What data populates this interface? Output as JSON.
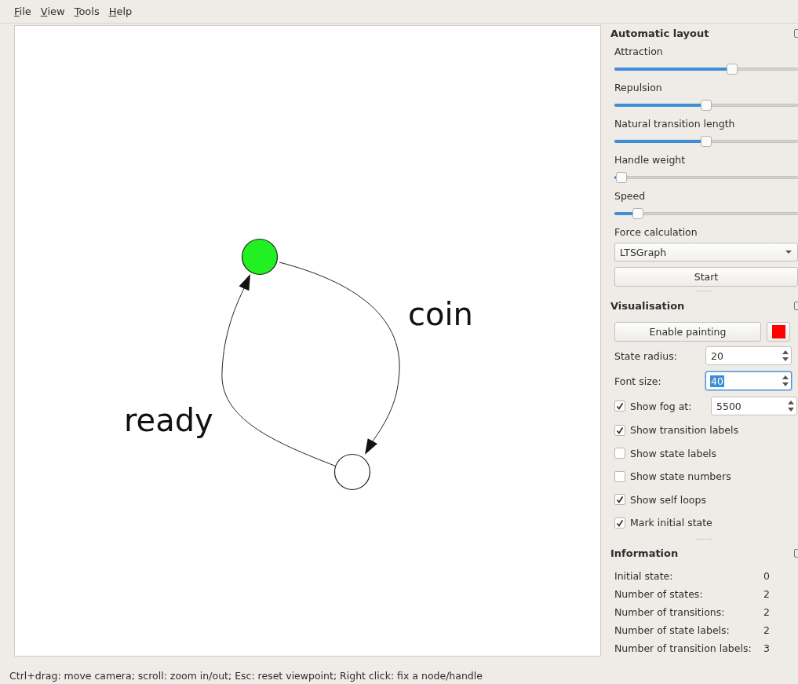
{
  "menu": [
    {
      "label": "File"
    },
    {
      "label": "View"
    },
    {
      "label": "Tools"
    },
    {
      "label": "Help"
    }
  ],
  "canvas": {
    "states": [
      {
        "color": "#22f022"
      },
      {
        "color": "#ffffff"
      }
    ],
    "transitions": [
      {
        "label": "coin"
      },
      {
        "label": "ready"
      }
    ]
  },
  "automatic_layout": {
    "title": "Automatic layout",
    "sliders": [
      {
        "label": "Attraction",
        "level": 0.64
      },
      {
        "label": "Repulsion",
        "level": 0.5
      },
      {
        "label": "Natural transition length",
        "level": 0.5
      },
      {
        "label": "Handle weight",
        "level": 0.04
      },
      {
        "label": "Speed",
        "level": 0.13
      }
    ],
    "force_calculation": {
      "label": "Force calculation",
      "value": "LTSGraph"
    },
    "start_button": "Start"
  },
  "visualisation": {
    "title": "Visualisation",
    "enable_painting": "Enable painting",
    "spinboxes": [
      {
        "label": "State radius:",
        "value": "20",
        "selected": false
      },
      {
        "label": "Font size:",
        "value": "40",
        "selected": true
      }
    ],
    "fog": {
      "label": "Show fog at:",
      "checked": true,
      "value": "5500"
    },
    "checkboxes": [
      {
        "label": "Show transition labels",
        "checked": true
      },
      {
        "label": "Show state labels",
        "checked": false
      },
      {
        "label": "Show state numbers",
        "checked": false
      },
      {
        "label": "Show self loops",
        "checked": true
      },
      {
        "label": "Mark initial state",
        "checked": true
      }
    ]
  },
  "information": {
    "title": "Information",
    "rows": [
      {
        "label": "Initial state:",
        "value": "0"
      },
      {
        "label": "Number of states:",
        "value": "2"
      },
      {
        "label": "Number of transitions:",
        "value": "2"
      },
      {
        "label": "Number of state labels:",
        "value": "2"
      },
      {
        "label": "Number of transition labels:",
        "value": "3"
      }
    ]
  },
  "status_bar": "Ctrl+drag: move camera; scroll: zoom in/out; Esc: reset viewpoint; Right click: fix a node/handle"
}
